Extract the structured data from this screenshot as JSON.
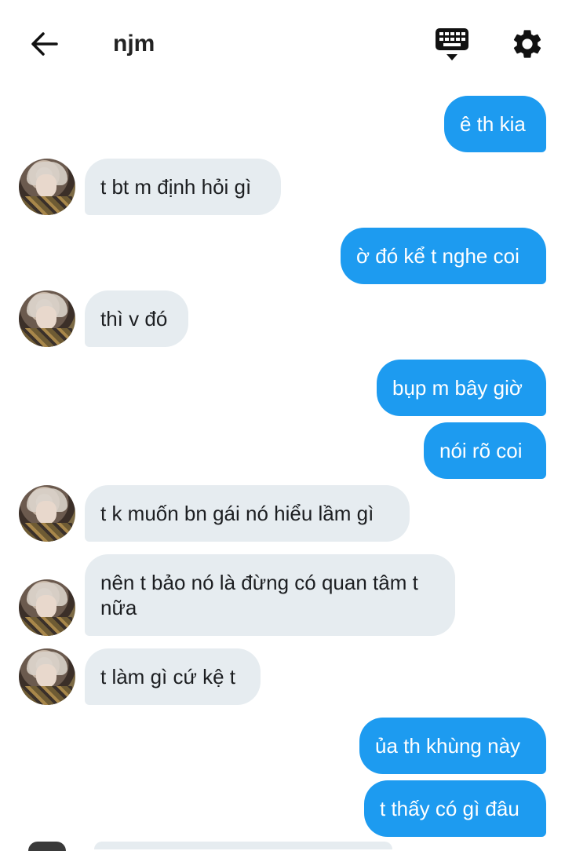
{
  "header": {
    "title": "njm",
    "back_icon": "arrow-left-icon",
    "keyboard_icon": "keyboard-icon",
    "settings_icon": "gear-icon"
  },
  "colors": {
    "outgoing_bubble": "#1d9bf0",
    "incoming_bubble": "#e6ecf0"
  },
  "messages": [
    {
      "dir": "out",
      "text": "ê th kia"
    },
    {
      "dir": "in",
      "text": "t bt m định hỏi gì"
    },
    {
      "dir": "out",
      "text": "ờ đó kể t nghe coi"
    },
    {
      "dir": "in",
      "text": "thì v đó"
    },
    {
      "dir": "out",
      "text": "bụp m bây giờ"
    },
    {
      "dir": "out",
      "text": "nói rõ coi"
    },
    {
      "dir": "in",
      "text": "t k muốn bn gái nó hiểu lầm gì"
    },
    {
      "dir": "in",
      "text": "nên t bảo nó là đừng có quan tâm t nữa"
    },
    {
      "dir": "in",
      "text": "t làm gì cứ kệ t"
    },
    {
      "dir": "out",
      "text": "ủa th khùng này"
    },
    {
      "dir": "out",
      "text": "t thấy có gì đâu"
    }
  ]
}
